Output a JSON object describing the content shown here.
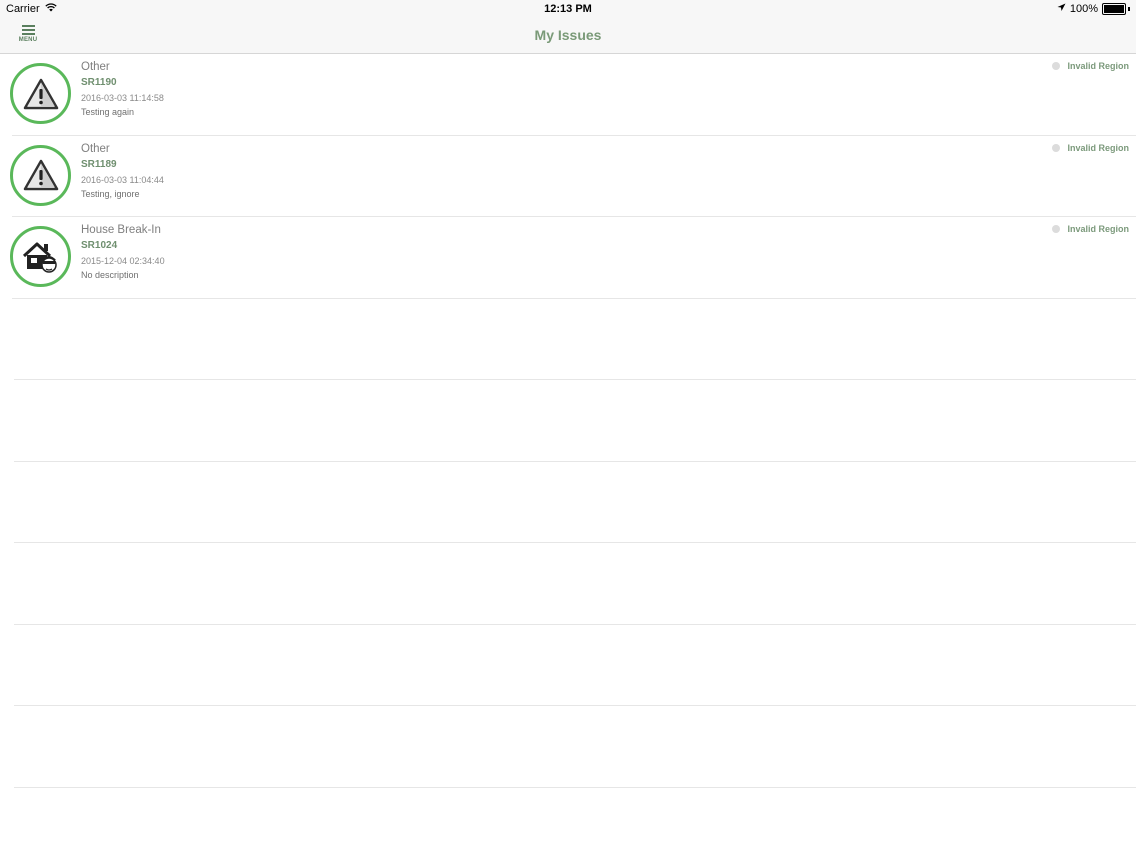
{
  "status_bar": {
    "carrier": "Carrier",
    "time": "12:13 PM",
    "battery": "100%",
    "battery_level": 1.0
  },
  "nav": {
    "menu_label": "MENU",
    "title": "My Issues"
  },
  "colors": {
    "accent_green": "#5ab85a",
    "title_green": "#7a9a78",
    "status_gray": "#dcdcdc"
  },
  "issues": [
    {
      "category": "Other",
      "id": "SR1190",
      "date": "2016-03-03 11:14:58",
      "description": "Testing again",
      "status": "Invalid Region",
      "icon": "warning-icon"
    },
    {
      "category": "Other",
      "id": "SR1189",
      "date": "2016-03-03 11:04:44",
      "description": "Testing, ignore",
      "status": "Invalid Region",
      "icon": "warning-icon"
    },
    {
      "category": "House Break-In",
      "id": "SR1024",
      "date": "2015-12-04 02:34:40",
      "description": "No description",
      "status": "Invalid Region",
      "icon": "house-burglar-icon"
    }
  ]
}
